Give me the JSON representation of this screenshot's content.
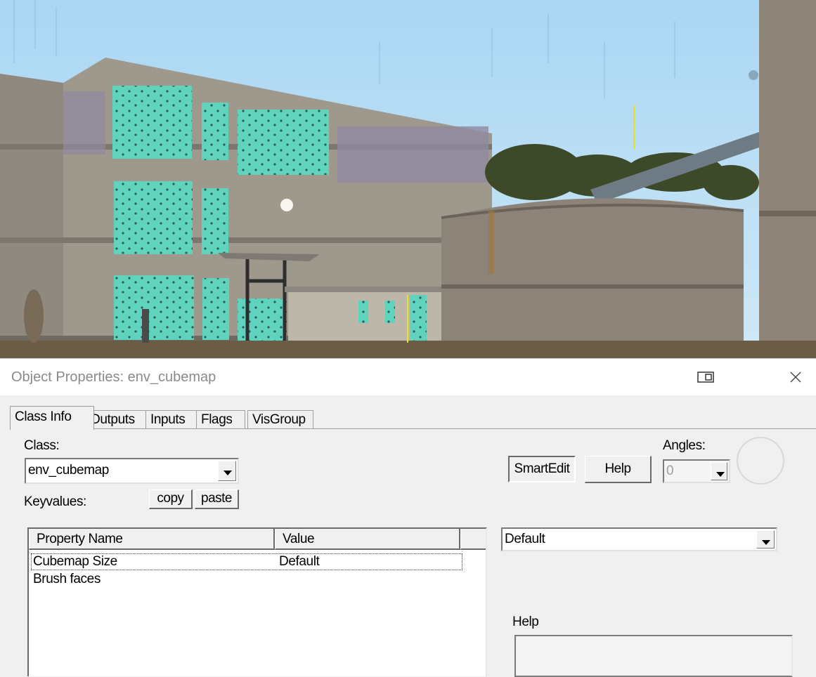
{
  "window": {
    "title": "Object Properties: env_cubemap"
  },
  "tabs": [
    {
      "label": "Class Info",
      "active": true
    },
    {
      "label": "Outputs",
      "active": false
    },
    {
      "label": "Inputs",
      "active": false
    },
    {
      "label": "Flags",
      "active": false
    },
    {
      "label": "VisGroup",
      "active": false
    }
  ],
  "class_info": {
    "class_label": "Class:",
    "class_value": "env_cubemap",
    "keyvalues_label": "Keyvalues:",
    "copy_label": "copy",
    "paste_label": "paste",
    "smartedit_label": "SmartEdit",
    "help_button_label": "Help",
    "angles_label": "Angles:",
    "angles_value": "0",
    "value_combo": "Default",
    "help_section_label": "Help",
    "help_text": ""
  },
  "keyvalues": {
    "columns": [
      "Property Name",
      "Value"
    ],
    "rows": [
      {
        "name": "Cubemap Size",
        "value": "Default",
        "selected": true
      },
      {
        "name": "Brush faces",
        "value": "",
        "selected": false
      }
    ]
  },
  "colors": {
    "sky": "#b9dcf2",
    "concrete": "#9a948a",
    "glass": "#5fd3bd"
  }
}
